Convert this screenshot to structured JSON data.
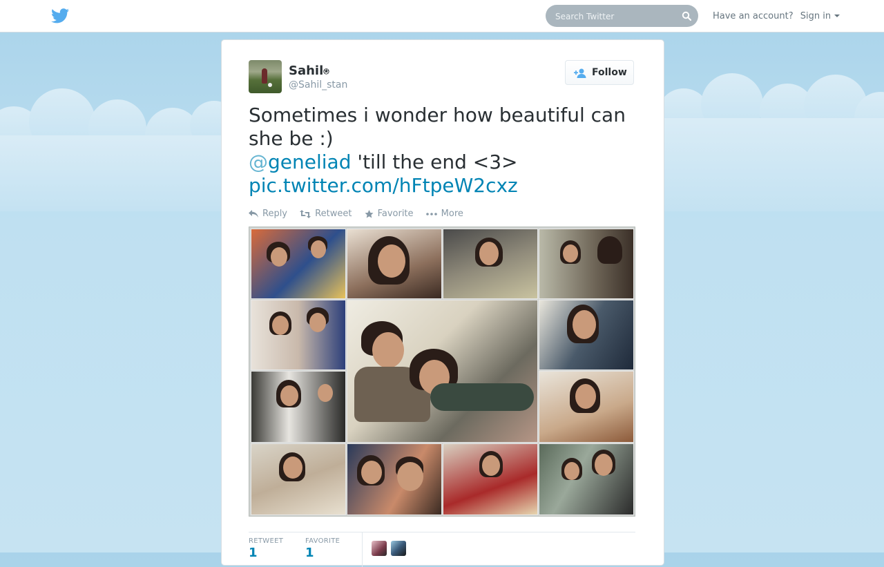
{
  "topbar": {
    "logo": "twitter-bird-icon",
    "search_placeholder": "Search Twitter",
    "search_icon": "search-icon",
    "have_account": "Have an account?",
    "sign_in": "Sign in"
  },
  "tweet": {
    "author_name": "Sahil",
    "verified_mark": "⍟",
    "author_handle": "@Sahil_stan",
    "follow_label": "Follow",
    "text_line1": "Sometimes i wonder how beautiful can she be :)",
    "mention_at": "@",
    "mention_name": "geneliad",
    "text_after_mention": " 'till the end <3>",
    "pic_link": "pic.twitter.com/hFtpeW2cxz",
    "actions": {
      "reply": "Reply",
      "retweet": "Retweet",
      "favorite": "Favorite",
      "more": "More"
    },
    "stats": {
      "retweets_label": "RETWEET",
      "retweets_value": "1",
      "favorites_label": "FAVORITE",
      "favorites_value": "1"
    }
  },
  "colors": {
    "link": "#0084b4",
    "twitter_blue": "#55acee",
    "sky": "#bfe0f1"
  }
}
